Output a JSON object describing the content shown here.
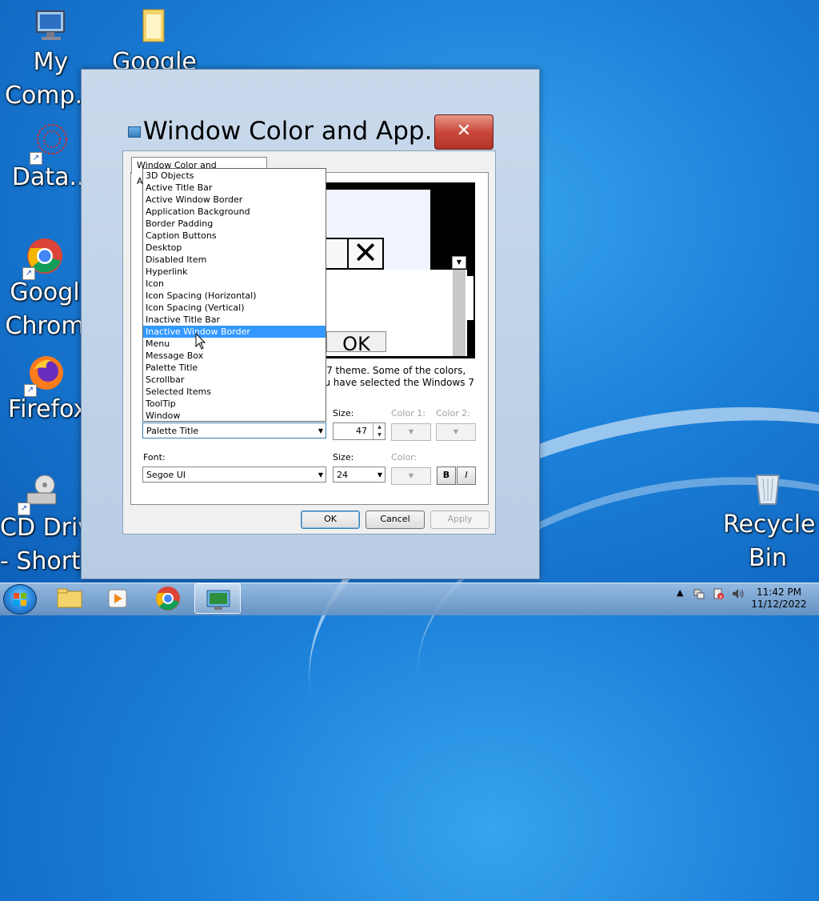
{
  "desktop": {
    "icons": [
      {
        "label1": "My",
        "label2": "Comp..."
      },
      {
        "label1": "Google",
        "label2": ""
      },
      {
        "label1": "Data...",
        "label2": ""
      },
      {
        "label1": "Googl",
        "label2": "Chrom"
      },
      {
        "label1": "Firefox",
        "label2": ""
      },
      {
        "label1": "CD Driv",
        "label2": "- Short"
      },
      {
        "label1": "Recycle",
        "label2": "Bin"
      }
    ]
  },
  "dialog": {
    "title": "Window Color and App...",
    "close_label": "✕",
    "tab_label": "Window Color and Appearance",
    "description_line1": "s 7 theme.  Some of the colors,",
    "description_line2": "ou have selected the Windows 7",
    "item_size_label": "Size:",
    "color1_label": "Color 1:",
    "color2_label": "Color 2:",
    "item_value": "Palette Title",
    "item_size_value": "47",
    "font_label": "Font:",
    "font_size_label": "Size:",
    "font_color_label": "Color:",
    "font_value": "Segoe UI",
    "font_size_value": "24",
    "bold_label": "B",
    "italic_label": "I",
    "ok_label": "OK",
    "cancel_label": "Cancel",
    "apply_label": "Apply",
    "preview_ok": "OK"
  },
  "dropdown": {
    "highlighted": "Inactive Window Border",
    "items": [
      "3D Objects",
      "Active Title Bar",
      "Active Window Border",
      "Application Background",
      "Border Padding",
      "Caption Buttons",
      "Desktop",
      "Disabled Item",
      "Hyperlink",
      "Icon",
      "Icon Spacing (Horizontal)",
      "Icon Spacing (Vertical)",
      "Inactive Title Bar",
      "Inactive Window Border",
      "Menu",
      "Message Box",
      "Palette Title",
      "Scrollbar",
      "Selected Items",
      "ToolTip",
      "Window"
    ]
  },
  "taskbar": {
    "time": "11:42 PM",
    "date": "11/12/2022"
  }
}
